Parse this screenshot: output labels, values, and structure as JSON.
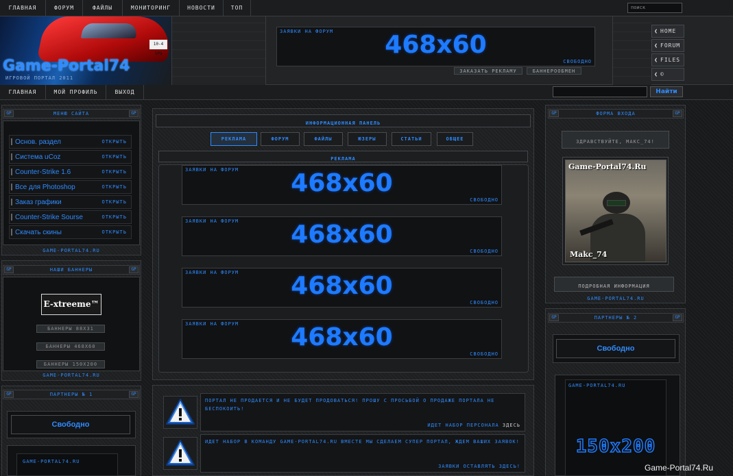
{
  "top_nav": {
    "items": [
      "ГЛАВНАЯ",
      "ФОРУМ",
      "ФАЙЛЫ",
      "МОНИТОРИНГ",
      "НОВОСТИ",
      "ТОП"
    ],
    "search_value": "поиск"
  },
  "header": {
    "logo_title": "Game-Portal74",
    "logo_subtitle": "ИГРОВОЙ ПОРТАЛ 2011",
    "plate_text": "10-4 SPQ",
    "banner": {
      "label": "ЗАЯВКИ НА ФОРУМ",
      "size": "468x60",
      "free": "СВОБОДНО"
    },
    "order_ad": "ЗАКАЗАТЬ РЕКЛАМУ",
    "banner_exchange": "БАННЕРООБМЕН",
    "side_links": [
      "HOME",
      "FORUM",
      "FILES",
      "©"
    ]
  },
  "sub_nav": {
    "items": [
      "ГЛАВНАЯ",
      "МОЙ ПРОФИЛЬ",
      "ВЫХОД"
    ],
    "login_button": "Найти"
  },
  "left": {
    "gp": "GP",
    "menu_title": "МЕНЮ САЙТА",
    "menu_items": [
      {
        "label": "Основ. раздел",
        "action": "ОТКРЫТЬ"
      },
      {
        "label": "Система uCoz",
        "action": "ОТКРЫТЬ"
      },
      {
        "label": "Counter-Strike 1.6",
        "action": "ОТКРЫТЬ"
      },
      {
        "label": "Все для Photoshop",
        "action": "ОТКРЫТЬ"
      },
      {
        "label": "Заказ графики",
        "action": "ОТКРЫТЬ"
      },
      {
        "label": "Counter-Strike Sourse",
        "action": "ОТКРЫТЬ"
      },
      {
        "label": "Скачать скины",
        "action": "ОТКРЫТЬ"
      }
    ],
    "footer": "GAME-PORTAL74.RU",
    "banners_title": "НАШИ БАННЕРЫ",
    "banner_logo": "E-xtreeme™",
    "banner_buttons": [
      "БАННЕРЫ 88x31",
      "БАННЕРЫ 468x60",
      "БАННЕРЫ 150x200"
    ],
    "partners_title": "ПАРТНЕРЫ № 1",
    "free": "Свободно",
    "partner_label": "GAME-PORTAL74.RU"
  },
  "center": {
    "panel_title": "ИНФОРМАЦИОННАЯ ПАНЕЛЬ",
    "tabs": [
      "РЕКЛАМА",
      "ФОРУМ",
      "ФАЙЛЫ",
      "ЮЗЕРЫ",
      "СТАТЬИ",
      "ОБЩЕЕ"
    ],
    "section_title": "РЕКЛАМА",
    "banners": [
      {
        "label": "ЗАЯВКИ НА ФОРУМ",
        "size": "468x60",
        "free": "СВОБОДНО"
      },
      {
        "label": "ЗАЯВКИ НА ФОРУМ",
        "size": "468x60",
        "free": "СВОБОДНО"
      },
      {
        "label": "ЗАЯВКИ НА ФОРУМ",
        "size": "468x60",
        "free": "СВОБОДНО"
      },
      {
        "label": "ЗАЯВКИ НА ФОРУМ",
        "size": "468x60",
        "free": "СВОБОДНО"
      }
    ],
    "notices": [
      {
        "message": "ПОРТАЛ НЕ ПРОДАЕТСЯ И НЕ БУДЕТ ПРОДОВАТЬСЯ! ПРОШУ С ПРОСЬБОЙ О ПРОДАЖЕ ПОРТАЛА НЕ БЕСПОКОИТЬ!",
        "link": "ИДЕТ НАБОР ПЕРСОНАЛА",
        "link_suffix": "ЗДЕСЬ"
      },
      {
        "message": "ИДЕТ НАБОР В КОМАНДУ GAME-PORTAL74.RU ВМЕСТЕ МЫ СДЕЛАЕМ СУПЕР ПОРТАЛ, ЖДЕМ ВАШИХ ЗАЯВОК!",
        "link": "ЗАЯВКИ ОСТАВЛЯТЬ ЗДЕСЬ!",
        "link_suffix": "ЗДЕСЬ"
      }
    ]
  },
  "right": {
    "gp": "GP",
    "login_title": "ФОРМА ВХОДА",
    "greeting": "ЗДРАВСТВУЙТЕ, МАКС_74!",
    "avatar_site": "Game-Portal74.Ru",
    "avatar_name": "Makc_74",
    "info_button": "ПОДРОБНАЯ ИНФОРМАЦИЯ",
    "footer": "GAME-PORTAL74.RU",
    "partners_title": "ПАРТНЕРЫ № 2",
    "free": "Свободно",
    "partner_label": "GAME-PORTAL74.RU",
    "banner_size": "150x200"
  },
  "watermark": "Game-Portal74.Ru"
}
